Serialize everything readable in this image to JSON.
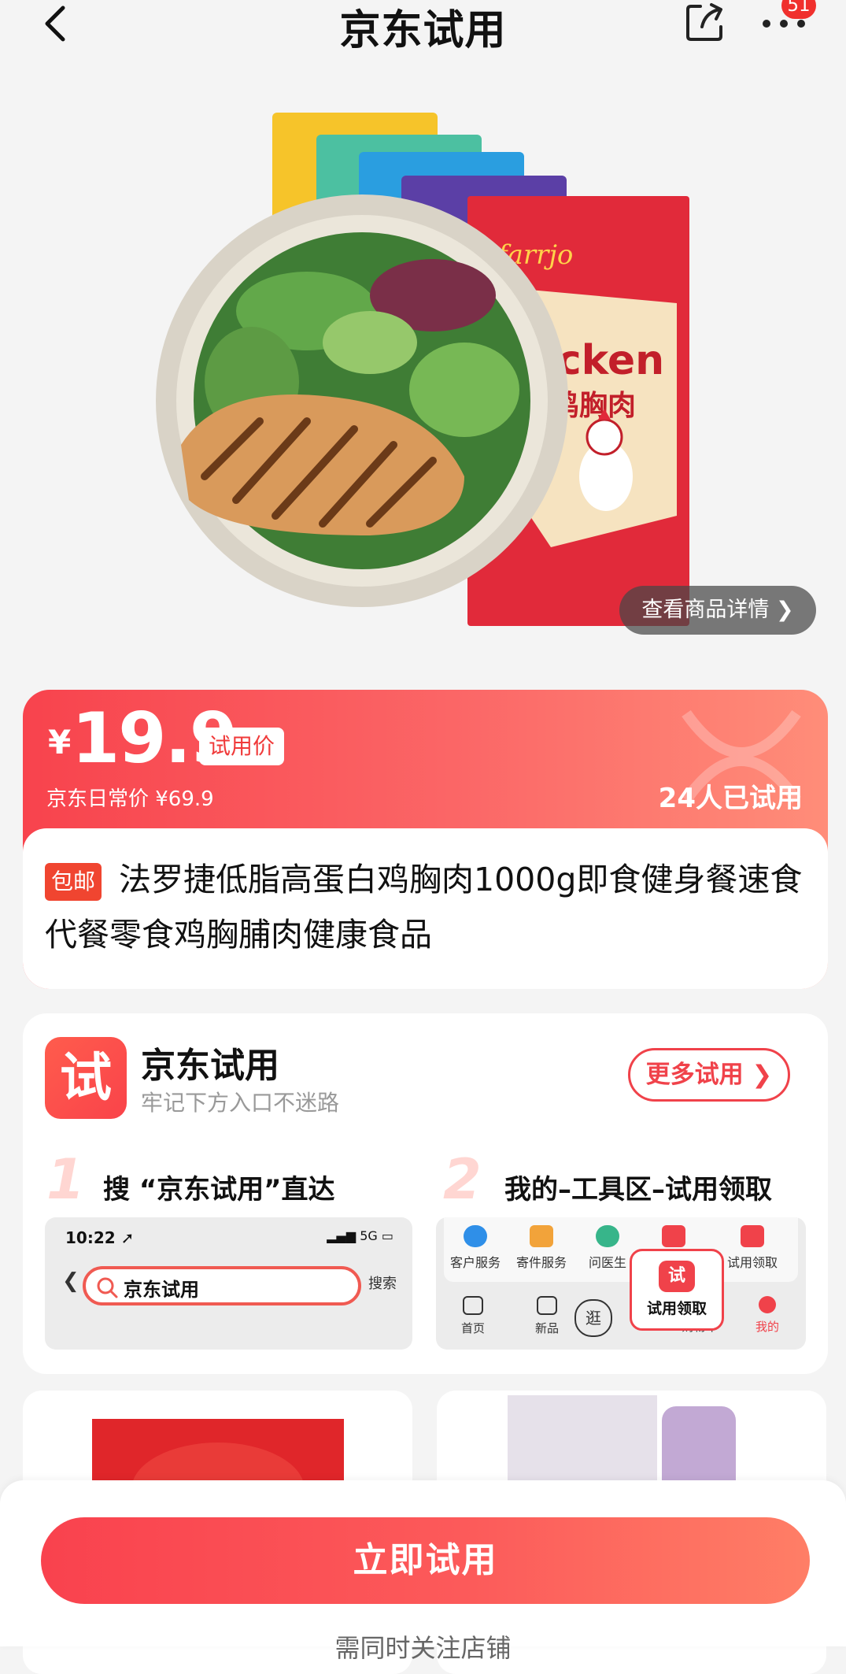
{
  "header": {
    "title": "京东试用",
    "badge_count": "51"
  },
  "hero": {
    "detail_button": "查看商品详情 ❯"
  },
  "price": {
    "currency": "¥",
    "value": "19.9",
    "tag": "试用价",
    "original": "京东日常价 ¥69.9",
    "tried": "24人已试用"
  },
  "product": {
    "tag": "包邮",
    "title": "法罗捷低脂高蛋白鸡胸肉1000g即食健身餐速食代餐零食鸡胸脯肉健康食品"
  },
  "guide": {
    "icon_char": "试",
    "title": "京东试用",
    "subtitle": "牢记下方入口不迷路",
    "more_button": "更多试用 ❯",
    "step1": {
      "num": "1",
      "text": "搜 “京东试用”直达",
      "time": "10:22 ➚",
      "signal": "▂▄▆ 5G ▭",
      "back": "❮",
      "search_value": "京东试用",
      "search_action": "搜索"
    },
    "step2": {
      "num": "2",
      "text": "我的–工具区–试用领取",
      "services": [
        "客户服务",
        "寄件服务",
        "问医生",
        "",
        "试用领取"
      ],
      "tabs": [
        "首页",
        "新品",
        "逛",
        "购物车",
        "我的"
      ],
      "popup_icon": "试",
      "popup_label": "试用领取"
    }
  },
  "bottom": {
    "cta": "立即试用",
    "follow": "需同时关注店铺"
  },
  "colors": {
    "accent": "#f9434a",
    "brand_red": "#f0424a"
  }
}
